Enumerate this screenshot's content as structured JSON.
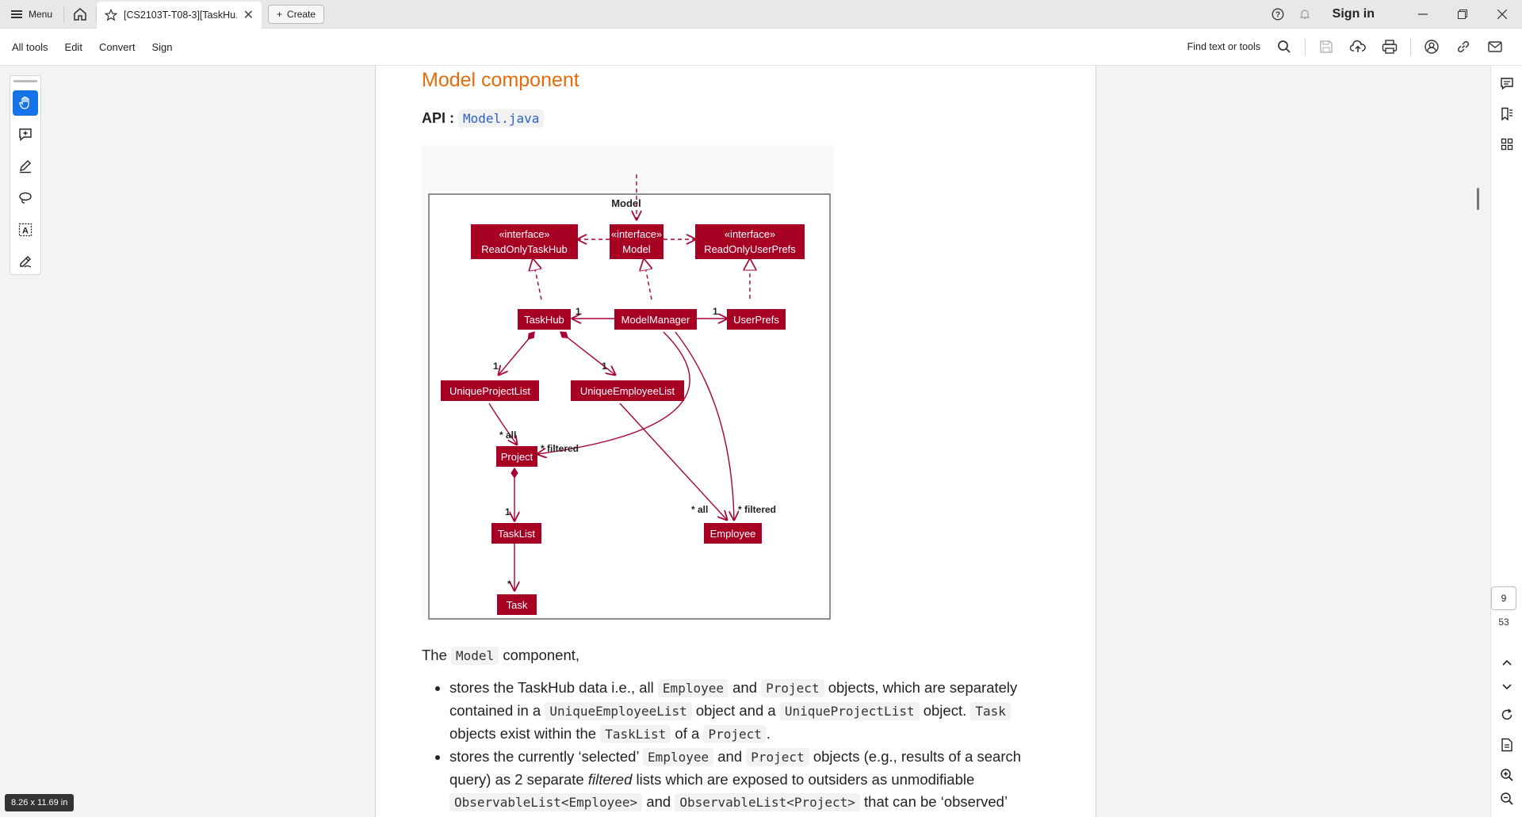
{
  "titlebar": {
    "menu_label": "Menu",
    "tab_title": "[CS2103T-T08-3][TaskHu...",
    "create_label": "Create",
    "signin_label": "Sign in"
  },
  "toolbar": {
    "items": [
      "All tools",
      "Edit",
      "Convert",
      "Sign"
    ],
    "find_label": "Find text or tools"
  },
  "document": {
    "heading": "Model component",
    "api_label": "API",
    "api_colon": " : ",
    "api_link": "Model.java",
    "diagram": {
      "title": "Model",
      "nodes": {
        "readonly_taskhub": [
          "«interface»",
          "ReadOnlyTaskHub"
        ],
        "model": [
          "«interface»",
          "Model"
        ],
        "readonly_userprefs": [
          "«interface»",
          "ReadOnlyUserPrefs"
        ],
        "taskhub": "TaskHub",
        "modelmanager": "ModelManager",
        "userprefs": "UserPrefs",
        "unique_project_list": "UniqueProjectList",
        "unique_employee_list": "UniqueEmployeeList",
        "project": "Project",
        "tasklist": "TaskList",
        "task": "Task",
        "employee": "Employee"
      },
      "labels": {
        "mm_taskhub": "1",
        "mm_userprefs": "1",
        "taskhub_upl": "1",
        "taskhub_uel": "1",
        "upl_project": "* all",
        "mm_project": "* filtered",
        "project_tasklist": "1",
        "uel_employee": "* all",
        "mm_employee": "* filtered",
        "tasklist_task": "*"
      }
    },
    "intro_pre": "The ",
    "intro_code": "Model",
    "intro_post": " component,",
    "bullet1": {
      "t1": "stores the TaskHub data i.e., all ",
      "c1": "Employee",
      "t2": " and ",
      "c2": "Project",
      "t3": " objects, which are separately contained in a ",
      "c3": "UniqueEmployeeList",
      "t4": " object and a ",
      "c4": "UniqueProjectList",
      "t5": " object. ",
      "c5": "Task",
      "t6": " objects exist within the ",
      "c6": "TaskList",
      "t7": " of a ",
      "c7": "Project",
      "t8": "."
    },
    "bullet2": {
      "t1": "stores the currently ‘selected’ ",
      "c1": "Employee",
      "t2": " and ",
      "c2": "Project",
      "t3": " objects (e.g., results of a search query) as 2 separate ",
      "em": "filtered",
      "t4": " lists which are exposed to outsiders as unmodifiable ",
      "c3": "ObservableList<Employee>",
      "t5": " and ",
      "c4": "ObservableList<Project>",
      "t6": " that can be ‘observed’"
    }
  },
  "navigation": {
    "current_page": "9",
    "total_pages": "53"
  },
  "status": {
    "page_size": "8.26 x 11.69 in"
  },
  "colors": {
    "accent": "#1473e6",
    "heading": "#e46c0a",
    "uml_node": "#a80022",
    "uml_line": "#a80036"
  }
}
